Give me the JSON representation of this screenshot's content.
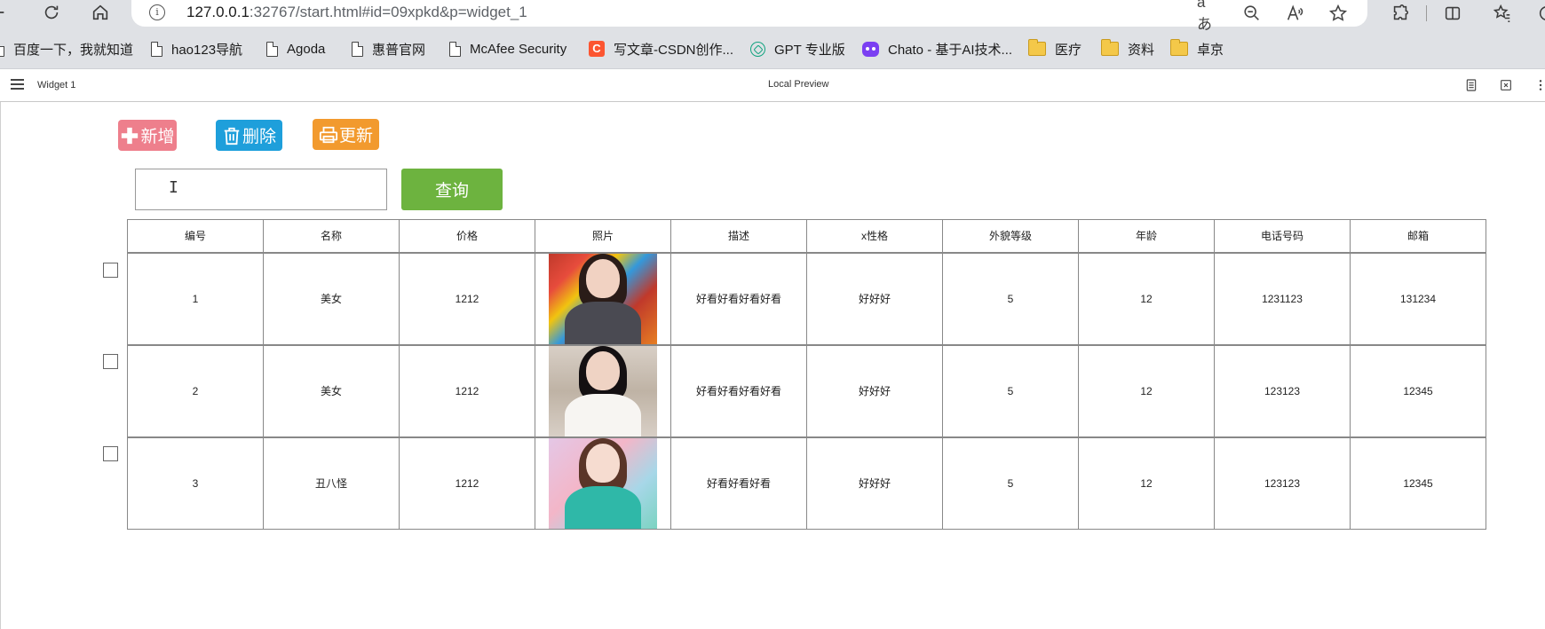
{
  "browser": {
    "url_host": "127.0.0.1",
    "url_rest": ":32767/start.html#id=09xpkd&p=widget_1",
    "read_aloud_label": "aあ",
    "bookmarks": [
      {
        "label": "百度一下，我就知道",
        "icon": "page-icon"
      },
      {
        "label": "hao123导航",
        "icon": "page-icon"
      },
      {
        "label": "Agoda",
        "icon": "page-icon"
      },
      {
        "label": "惠普官网",
        "icon": "page-icon"
      },
      {
        "label": "McAfee Security",
        "icon": "page-icon"
      },
      {
        "label": "写文章-CSDN创作...",
        "icon": "csdn-icon",
        "icon_text": "C"
      },
      {
        "label": "GPT 专业版",
        "icon": "gpt-icon"
      },
      {
        "label": "Chato - 基于AI技术...",
        "icon": "chato-icon"
      },
      {
        "label": "医疗",
        "icon": "folder-icon"
      },
      {
        "label": "资料",
        "icon": "folder-icon"
      },
      {
        "label": "卓京",
        "icon": "folder-icon"
      }
    ]
  },
  "app": {
    "title": "Widget 1",
    "center_label": "Local Preview"
  },
  "toolbar": {
    "add_label": "新增",
    "delete_label": "删除",
    "update_label": "更新",
    "query_label": "查询",
    "search_value": "",
    "search_placeholder": ""
  },
  "colors": {
    "add": "#ee7f8c",
    "delete": "#1e9fdb",
    "update": "#f29a2e",
    "query": "#6db33f"
  },
  "table": {
    "headers": [
      "编号",
      "名称",
      "价格",
      "照片",
      "描述",
      "x性格",
      "外貌等级",
      "年龄",
      "电话号码",
      "邮箱"
    ],
    "rows": [
      {
        "id": "1",
        "name": "美女",
        "price": "1212",
        "photo": "photo-1",
        "desc": "好看好看好看好看",
        "personality": "好好好",
        "looks": "5",
        "age": "12",
        "phone": "1231123",
        "email": "131234",
        "checked": false
      },
      {
        "id": "2",
        "name": "美女",
        "price": "1212",
        "photo": "photo-2",
        "desc": "好看好看好看好看",
        "personality": "好好好",
        "looks": "5",
        "age": "12",
        "phone": "123123",
        "email": "12345",
        "checked": false
      },
      {
        "id": "3",
        "name": "丑八怪",
        "price": "1212",
        "photo": "photo-3",
        "desc": "好看好看好看",
        "personality": "好好好",
        "looks": "5",
        "age": "12",
        "phone": "123123",
        "email": "12345",
        "checked": false
      }
    ]
  }
}
